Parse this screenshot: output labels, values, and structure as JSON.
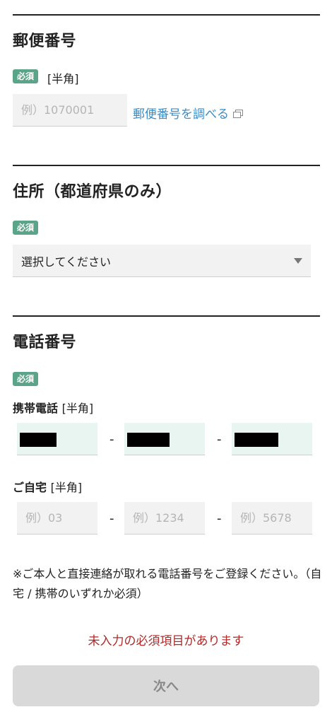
{
  "postal": {
    "heading": "郵便番号",
    "required_badge": "必須",
    "halfwidth_note": "[半角]",
    "placeholder": "例）1070001",
    "lookup_link": "郵便番号を調べる"
  },
  "address": {
    "heading": "住所（都道府県のみ）",
    "required_badge": "必須",
    "select_value": "選択してください"
  },
  "phone": {
    "heading": "電話番号",
    "required_badge": "必須",
    "mobile_label": "携帯電話",
    "mobile_note": "[半角]",
    "home_label": "ご自宅",
    "home_note": "[半角]",
    "home_placeholders": [
      "例）03",
      "例）1234",
      "例）5678"
    ],
    "separator": "-",
    "help_text": "※ご本人と直接連絡が取れる電話番号をご登録ください。（自宅 / 携帯のいずれか必須）"
  },
  "error_message": "未入力の必須項目があります",
  "next_button": "次へ",
  "colors": {
    "accent_badge": "#5aa58a",
    "link": "#3a8cc7",
    "error": "#b02a2a",
    "filled_field": "#e8f5f1"
  }
}
